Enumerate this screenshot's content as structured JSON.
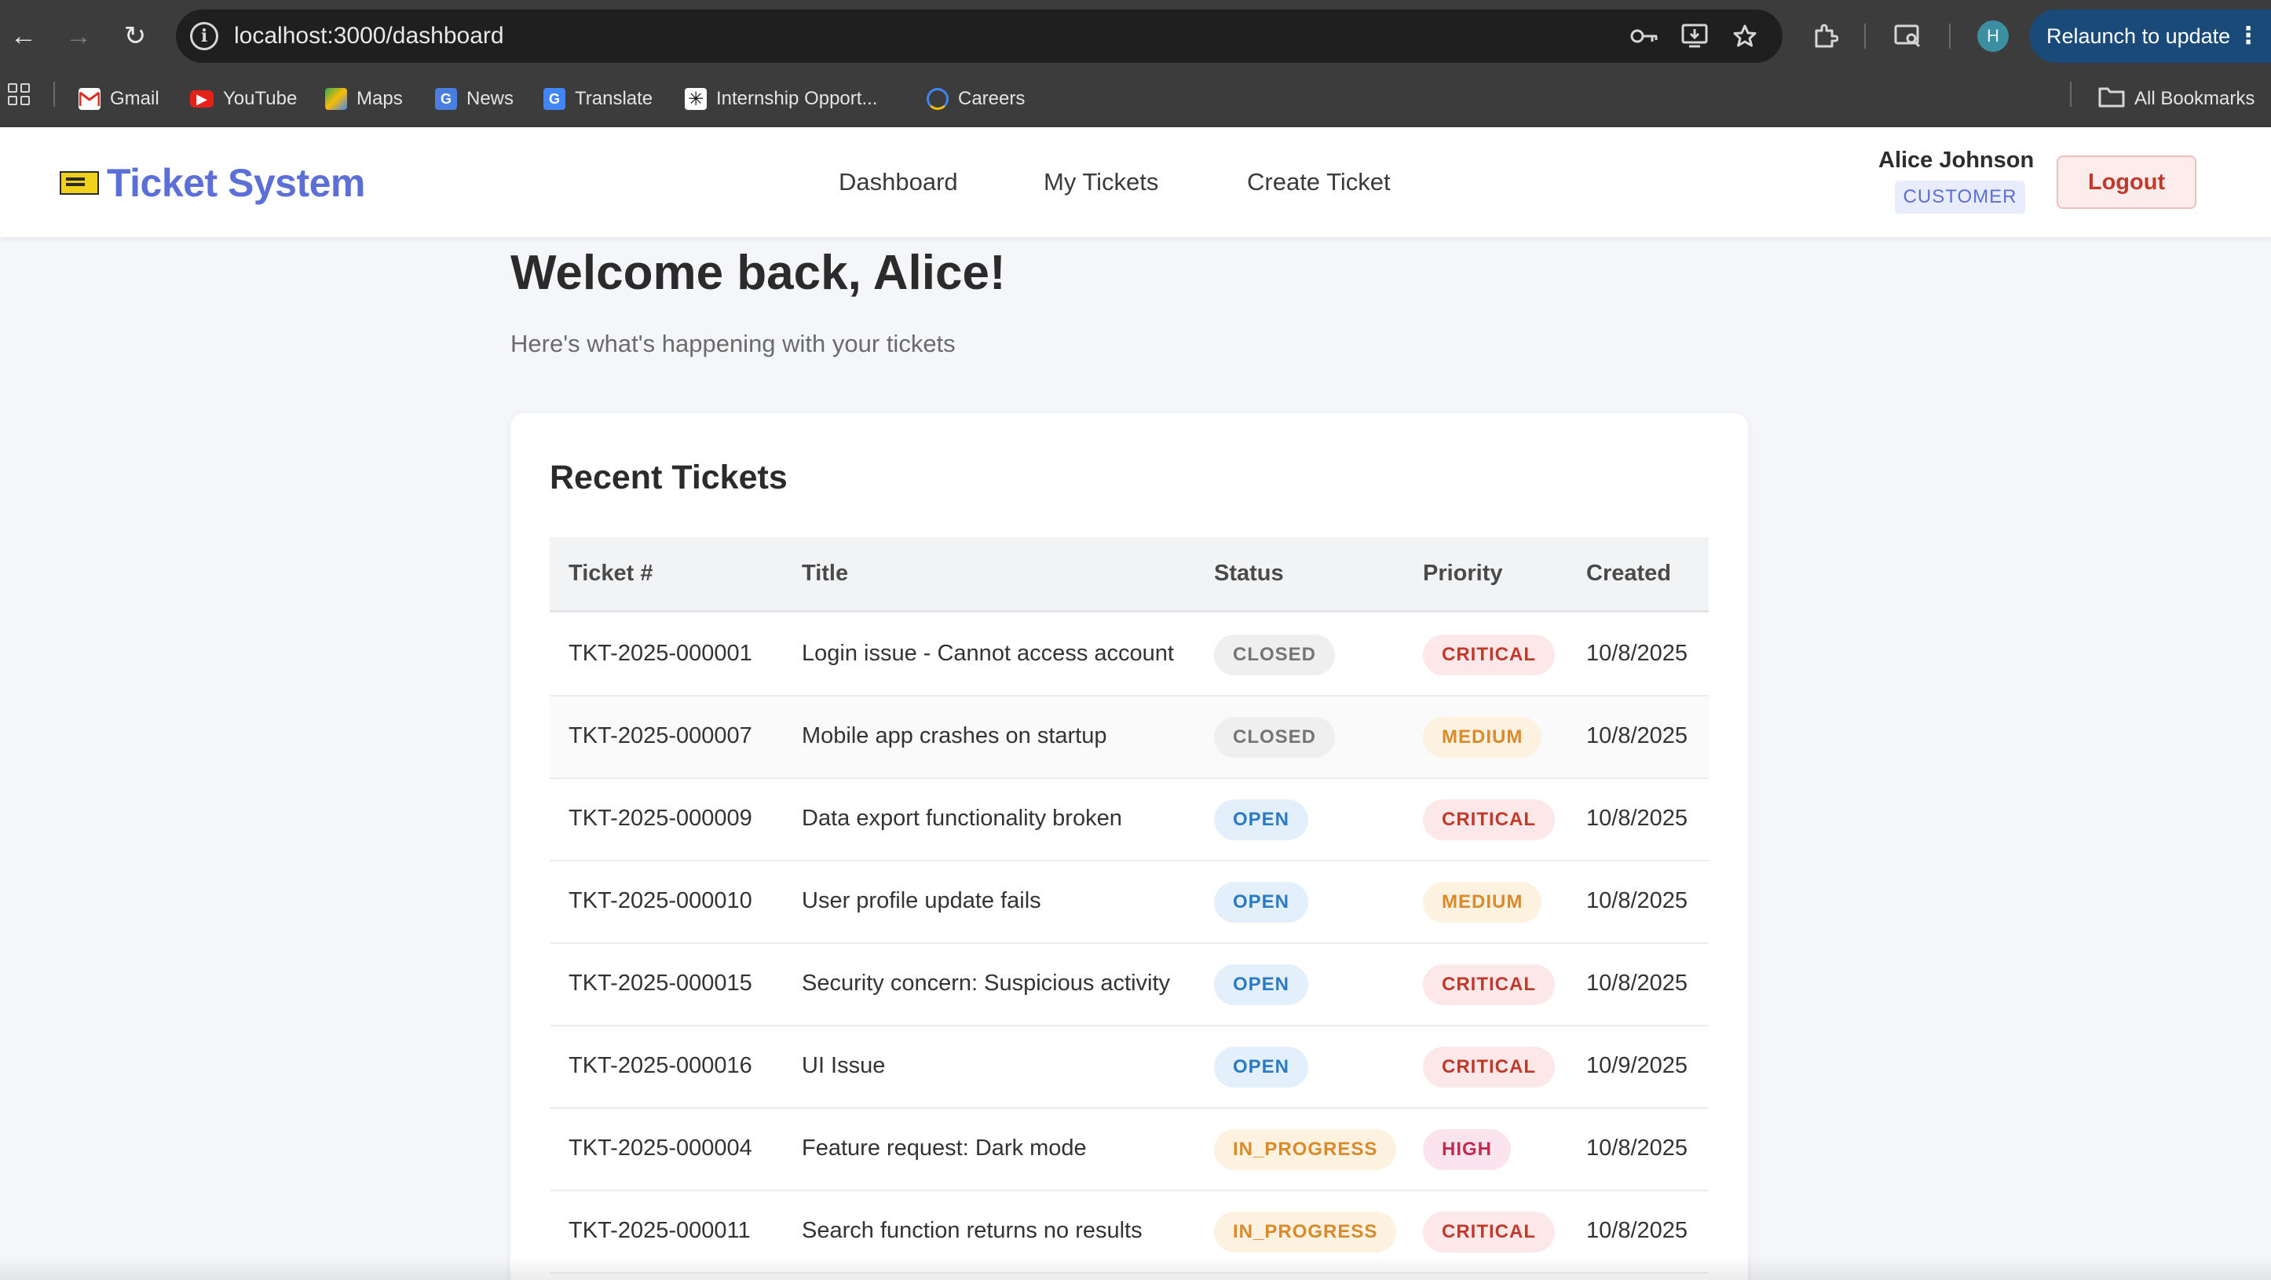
{
  "browser": {
    "url": "localhost:3000/dashboard",
    "profile_initial": "H",
    "relaunch_label": "Relaunch to update",
    "bookmarks": [
      {
        "label": "Gmail",
        "icon": "gmail-icon"
      },
      {
        "label": "YouTube",
        "icon": "youtube-icon"
      },
      {
        "label": "Maps",
        "icon": "maps-icon"
      },
      {
        "label": "News",
        "icon": "news-icon"
      },
      {
        "label": "Translate",
        "icon": "translate-icon"
      },
      {
        "label": "Internship Opport...",
        "icon": "internship-icon"
      },
      {
        "label": "Careers",
        "icon": "careers-icon"
      }
    ],
    "all_bookmarks_label": "All Bookmarks"
  },
  "header": {
    "brand": "Ticket System",
    "nav": [
      "Dashboard",
      "My Tickets",
      "Create Ticket"
    ],
    "user_name": "Alice Johnson",
    "user_role": "CUSTOMER",
    "logout_label": "Logout"
  },
  "page": {
    "welcome": "Welcome back, Alice!",
    "subtitle": "Here's what's happening with your tickets"
  },
  "recent": {
    "title": "Recent Tickets",
    "columns": [
      "Ticket #",
      "Title",
      "Status",
      "Priority",
      "Created"
    ],
    "rows": [
      {
        "id": "TKT-2025-000001",
        "title": "Login issue - Cannot access account",
        "status": "CLOSED",
        "priority": "CRITICAL",
        "created": "10/8/2025"
      },
      {
        "id": "TKT-2025-000007",
        "title": "Mobile app crashes on startup",
        "status": "CLOSED",
        "priority": "MEDIUM",
        "created": "10/8/2025"
      },
      {
        "id": "TKT-2025-000009",
        "title": "Data export functionality broken",
        "status": "OPEN",
        "priority": "CRITICAL",
        "created": "10/8/2025"
      },
      {
        "id": "TKT-2025-000010",
        "title": "User profile update fails",
        "status": "OPEN",
        "priority": "MEDIUM",
        "created": "10/8/2025"
      },
      {
        "id": "TKT-2025-000015",
        "title": "Security concern: Suspicious activity",
        "status": "OPEN",
        "priority": "CRITICAL",
        "created": "10/8/2025"
      },
      {
        "id": "TKT-2025-000016",
        "title": "UI Issue",
        "status": "OPEN",
        "priority": "CRITICAL",
        "created": "10/9/2025"
      },
      {
        "id": "TKT-2025-000004",
        "title": "Feature request: Dark mode",
        "status": "IN_PROGRESS",
        "priority": "HIGH",
        "created": "10/8/2025"
      },
      {
        "id": "TKT-2025-000011",
        "title": "Search function returns no results",
        "status": "IN_PROGRESS",
        "priority": "CRITICAL",
        "created": "10/8/2025"
      }
    ]
  },
  "colors": {
    "brand": "#5b6fd6",
    "status_closed_bg": "#efefef",
    "status_closed_fg": "#757575",
    "status_open_bg": "#e3f0fb",
    "status_open_fg": "#2a7bc4",
    "status_in_progress_bg": "#fdf1df",
    "status_in_progress_fg": "#d98a2b",
    "priority_critical_bg": "#fce8e8",
    "priority_critical_fg": "#c0392b",
    "priority_medium_bg": "#fdf1df",
    "priority_medium_fg": "#d98a2b",
    "priority_high_bg": "#fce4ee",
    "priority_high_fg": "#c4294f"
  }
}
